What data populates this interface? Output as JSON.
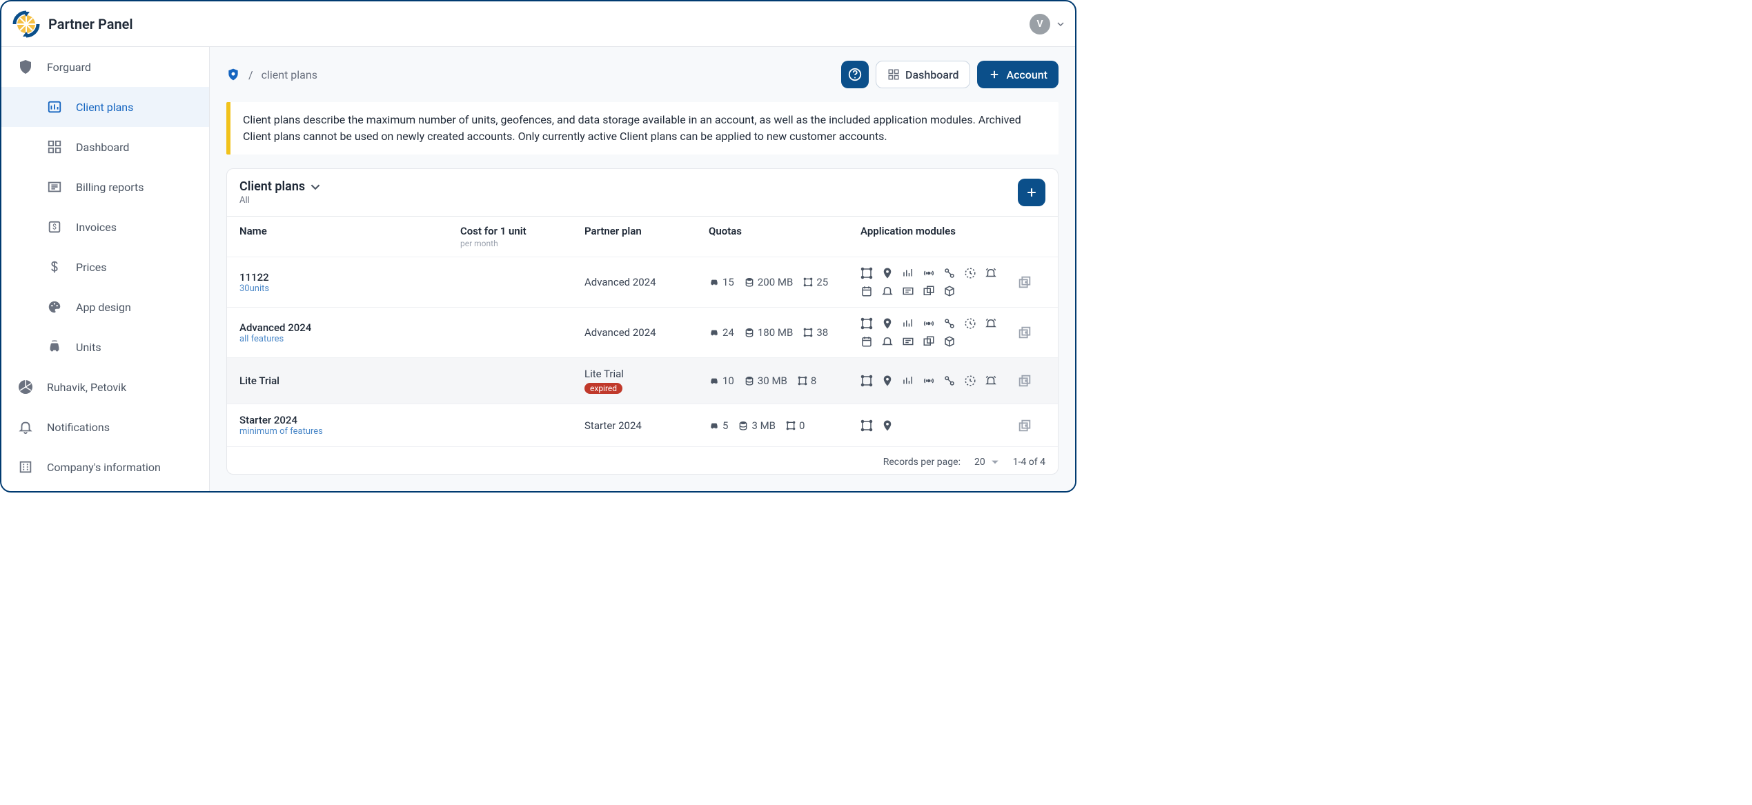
{
  "app": {
    "title": "Partner Panel",
    "avatar_initial": "V"
  },
  "sidebar": {
    "group1_label": "Forguard",
    "items": [
      {
        "label": "Client plans",
        "active": true
      },
      {
        "label": "Dashboard"
      },
      {
        "label": "Billing reports"
      },
      {
        "label": "Invoices"
      },
      {
        "label": "Prices"
      },
      {
        "label": "App design"
      },
      {
        "label": "Units"
      }
    ],
    "group2_label": "Ruhavik, Petovik",
    "bottom": [
      {
        "label": "Notifications"
      },
      {
        "label": "Company's information"
      }
    ]
  },
  "breadcrumb": {
    "label": "client plans",
    "sep": "/"
  },
  "actions": {
    "dashboard": "Dashboard",
    "account": "Account"
  },
  "banner": "Client plans describe the maximum number of units, geofences, and data storage available in an account, as well as the included application modules. Archived Client plans cannot be used on newly created accounts. Only currently active Client plans can be applied to new customer accounts.",
  "table": {
    "title": "Client plans",
    "subtitle": "All",
    "columns": {
      "name": "Name",
      "cost": "Cost for 1 unit",
      "cost_sub": "per month",
      "partner_plan": "Partner plan",
      "quotas": "Quotas",
      "modules": "Application modules"
    },
    "rows": [
      {
        "name": "11122",
        "desc": "30units",
        "partner_plan": "Advanced 2024",
        "expired": false,
        "quota_units": "15",
        "quota_storage": "200 MB",
        "quota_geofences": "25",
        "module_count": 12
      },
      {
        "name": "Advanced 2024",
        "desc": "all features",
        "partner_plan": "Advanced 2024",
        "expired": false,
        "quota_units": "24",
        "quota_storage": "180 MB",
        "quota_geofences": "38",
        "module_count": 12
      },
      {
        "name": "Lite Trial",
        "desc": "",
        "partner_plan": "Lite Trial",
        "expired": true,
        "expired_label": "expired",
        "quota_units": "10",
        "quota_storage": "30 MB",
        "quota_geofences": "8",
        "module_count": 7,
        "hover": true
      },
      {
        "name": "Starter 2024",
        "desc": "minimum of features",
        "partner_plan": "Starter 2024",
        "expired": false,
        "quota_units": "5",
        "quota_storage": "3 MB",
        "quota_geofences": "0",
        "module_count": 2
      }
    ]
  },
  "pager": {
    "label": "Records per page:",
    "page_size": "20",
    "range": "1-4 of 4"
  }
}
